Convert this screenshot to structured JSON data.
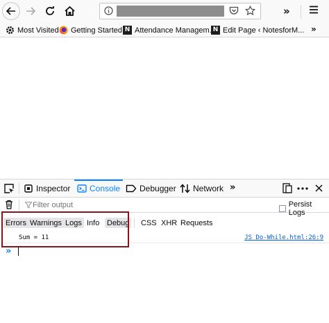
{
  "browser": {
    "url_redacted": true,
    "bookmarks": [
      {
        "label": "Most Visited",
        "icon": "gear-icon"
      },
      {
        "label": "Getting Started",
        "icon": "firefox-icon"
      },
      {
        "label": "Attendance Managem...",
        "icon": "notion-icon"
      },
      {
        "label": "Edit Page ‹ NotesforM...",
        "icon": "notion-icon"
      }
    ],
    "notion_letter": "N",
    "more": "»"
  },
  "devtools": {
    "tabs": [
      {
        "label": "Inspector",
        "icon": "inspector-icon"
      },
      {
        "label": "Console",
        "icon": "console-icon",
        "selected": true
      },
      {
        "label": "Debugger",
        "icon": "debugger-icon"
      },
      {
        "label": "Network",
        "icon": "network-icon"
      }
    ],
    "tabs_more": "»",
    "filter_placeholder": "Filter output",
    "persist_logs_label": "Persist Logs",
    "levels": [
      "Errors",
      "Warnings",
      "Logs",
      "Info",
      "Debug"
    ],
    "categories": [
      "CSS",
      "XHR",
      "Requests"
    ],
    "messages": [
      {
        "text": "Sum = 11",
        "source": "JS_Do-While.html:26:9"
      }
    ],
    "prompt": "»"
  },
  "colors": {
    "accent": "#0a84ff",
    "highlight": "#86141b",
    "link": "#0060df"
  }
}
